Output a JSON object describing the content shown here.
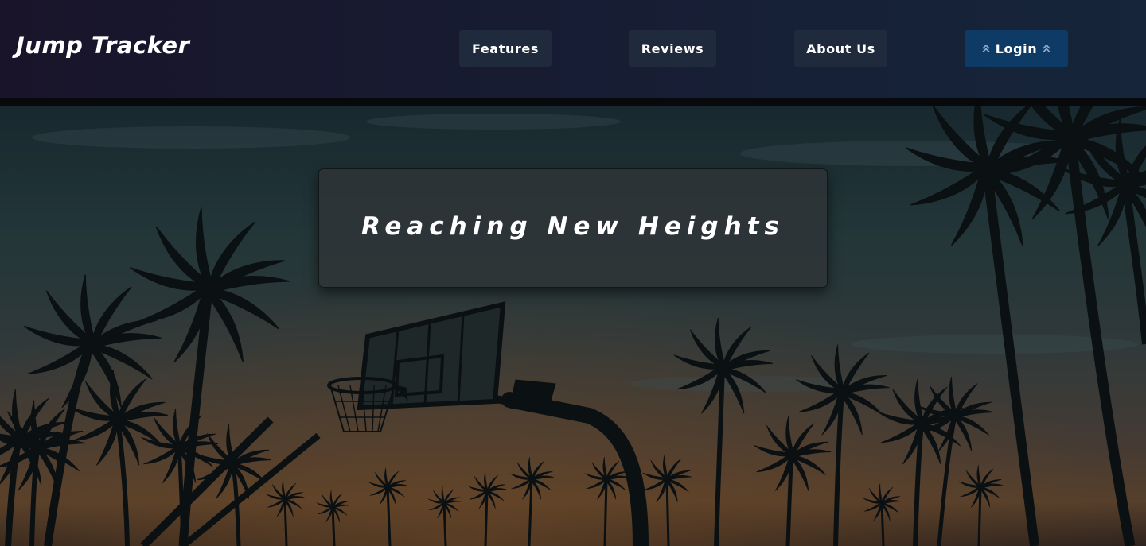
{
  "brand": {
    "name": "Jump Tracker"
  },
  "nav": {
    "features_label": "Features",
    "reviews_label": "Reviews",
    "about_label": "About Us",
    "login_label": "Login",
    "login_icon": "double-chevron-up-icon"
  },
  "hero": {
    "tagline": "Reaching New Heights",
    "background_image": "basketball hoop and palm trees silhouette at sunset"
  },
  "colors": {
    "nav_bg_start": "#19142a",
    "nav_bg_end": "#16253a",
    "nav_button_bg": "#1f2a3c",
    "login_button_bg": "#0e3a66",
    "tagline_box_bg": "#303537",
    "text": "#ffffff"
  }
}
